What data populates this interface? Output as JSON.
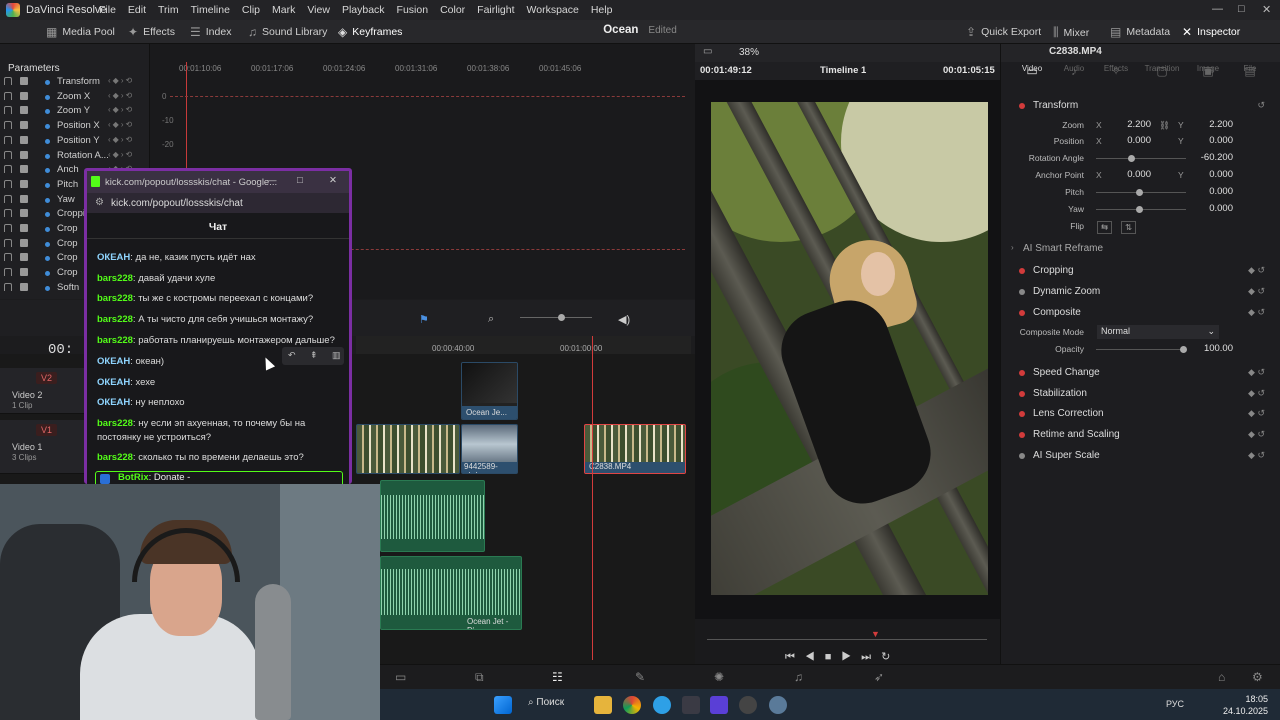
{
  "app": {
    "title": "DaVinci Resolve",
    "project": "Ocean",
    "status": "Edited"
  },
  "menu": [
    "File",
    "Edit",
    "Trim",
    "Timeline",
    "Clip",
    "Mark",
    "View",
    "Playback",
    "Fusion",
    "Color",
    "Fairlight",
    "Workspace",
    "Help"
  ],
  "toolbar": {
    "media_pool": "Media Pool",
    "effects": "Effects",
    "index": "Index",
    "sound_library": "Sound Library",
    "keyframes": "Keyframes",
    "quick_export": "Quick Export",
    "mixer": "Mixer",
    "metadata": "Metadata",
    "inspector": "Inspector"
  },
  "params": {
    "header": "Parameters",
    "items": [
      "Transform",
      "Zoom X",
      "Zoom Y",
      "Position X",
      "Position Y",
      "Rotation A...",
      "Anch",
      "Pitch",
      "Yaw",
      "Croppin",
      "Crop",
      "Crop",
      "Crop",
      "Crop",
      "Softn"
    ]
  },
  "keyframe_ruler": [
    "00:01:10:06",
    "00:01:17:06",
    "00:01:24:06",
    "00:01:31:06",
    "00:01:38:06",
    "00:01:45:06"
  ],
  "keyframe_yaxis": [
    "0",
    "-10",
    "-20"
  ],
  "timeline": {
    "ruler": [
      "00:00:40:00",
      "00:01:00:00"
    ],
    "timecode": "00:",
    "tracks": [
      {
        "tag": "V2",
        "name": "Video 2",
        "sub": "1 Clip"
      },
      {
        "tag": "V1",
        "name": "Video 1",
        "sub": "3 Clips"
      }
    ],
    "clips": {
      "v2": "Ocean Je...",
      "v1a": "9442589-uhd...",
      "v1b": "C2838.MP4",
      "audio": "Ocean Jet - Di..."
    }
  },
  "viewer": {
    "zoom": "38%",
    "timeline_name": "Timeline 1",
    "tc_left": "00:01:49:12",
    "tc_right": "00:01:05:15"
  },
  "inspector": {
    "clip_name": "C2838.MP4",
    "tabs": [
      "Video",
      "Audio",
      "Effects",
      "Transition",
      "Image",
      "File"
    ],
    "transform": "Transform",
    "zoom": {
      "label": "Zoom",
      "x": "2.200",
      "y": "2.200"
    },
    "position": {
      "label": "Position",
      "x": "0.000",
      "y": "0.000"
    },
    "rotation": {
      "label": "Rotation Angle",
      "v": "-60.200"
    },
    "anchor": {
      "label": "Anchor Point",
      "x": "0.000",
      "y": "0.000"
    },
    "pitch": {
      "label": "Pitch",
      "v": "0.000"
    },
    "yaw": {
      "label": "Yaw",
      "v": "0.000"
    },
    "flip": "Flip",
    "ai_reframe": "AI Smart Reframe",
    "sections": [
      "Cropping",
      "Dynamic Zoom",
      "Composite",
      "Speed Change",
      "Stabilization",
      "Lens Correction",
      "Retime and Scaling",
      "AI Super Scale"
    ],
    "composite_mode": {
      "label": "Composite Mode",
      "value": "Normal"
    },
    "opacity": {
      "label": "Opacity",
      "value": "100.00"
    }
  },
  "chat": {
    "window_title": "kick.com/popout/lossskis/chat - Google...",
    "url": "kick.com/popout/lossskis/chat",
    "header": "Чат",
    "messages": [
      {
        "user": "ОКЕАН",
        "text": ": да не, казик пусть идёт нах"
      },
      {
        "user": "bars228",
        "text": ": давай удачи хуле"
      },
      {
        "user": "bars228",
        "text": ": ты же с костромы переехал с концами?"
      },
      {
        "user": "bars228",
        "text": ": А ты чисто для себя учишься монтажу?"
      },
      {
        "user": "bars228",
        "text": ": работать планируешь монтажером дальше?"
      },
      {
        "user": "ОКЕАН",
        "text": ": океан)"
      },
      {
        "user": "ОКЕАН",
        "text": ": хехе"
      },
      {
        "user": "ОКЕАН",
        "text": ": ну неплохо"
      },
      {
        "user": "bars228",
        "text": ": ну если эп ахуенная, то почему бы на постоянку не устроиться?"
      },
      {
        "user": "bars228",
        "text": ": сколько ты по времени делаешь это?"
      }
    ],
    "bot": {
      "user": "BotRix",
      "text": ": Donate -"
    }
  },
  "taskbar": {
    "search": "Поиск",
    "lang": "РУС",
    "time": "18:05",
    "date": "24.10.2025"
  },
  "colors": {
    "accent": "#d23b3b",
    "kick_green": "#53fc18",
    "popup_border": "#7b2ea3"
  }
}
